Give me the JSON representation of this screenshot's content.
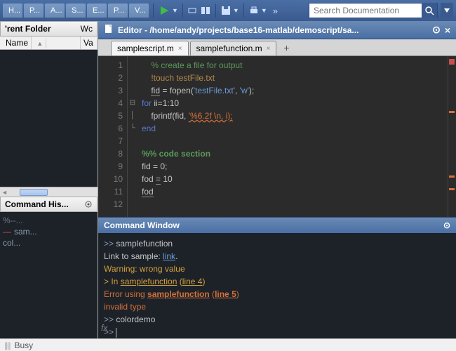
{
  "toolbar": {
    "tabs": [
      "H...",
      "P...",
      "A...",
      "S...",
      "E...",
      "P...",
      "V..."
    ],
    "search_placeholder": "Search Documentation"
  },
  "folder": {
    "title": "'rent Folder",
    "wc": "Wc",
    "col_name": "Name",
    "col_val": "Va"
  },
  "history": {
    "title": "Command His...",
    "lines": [
      "%--...",
      "sam...",
      "col..."
    ]
  },
  "editor": {
    "title": "Editor - /home/andy/projects/base16-matlab/demoscript/sa...",
    "tabs": [
      {
        "label": "samplescript.m",
        "active": true
      },
      {
        "label": "samplefunction.m",
        "active": false
      }
    ],
    "code": [
      {
        "n": 1,
        "seg": [
          {
            "t": "    ",
            "c": ""
          },
          {
            "t": "% create a file for output",
            "c": "c-comment"
          }
        ]
      },
      {
        "n": 2,
        "seg": [
          {
            "t": "    ",
            "c": ""
          },
          {
            "t": "!touch testFile.txt",
            "c": "c-cmd"
          }
        ]
      },
      {
        "n": 3,
        "seg": [
          {
            "t": "    ",
            "c": ""
          },
          {
            "t": "fid",
            "c": "c-var und"
          },
          {
            "t": " = fopen(",
            "c": "c-var"
          },
          {
            "t": "'testFile.txt'",
            "c": "c-str"
          },
          {
            "t": ", ",
            "c": "c-var"
          },
          {
            "t": "'w'",
            "c": "c-str"
          },
          {
            "t": ");",
            "c": "c-var"
          }
        ]
      },
      {
        "n": 4,
        "seg": [
          {
            "t": "for",
            "c": "c-key"
          },
          {
            "t": " ii=1:10",
            "c": "c-var"
          }
        ]
      },
      {
        "n": 5,
        "seg": [
          {
            "t": "    fprintf(fid, ",
            "c": "c-var"
          },
          {
            "t": "'%6.2f \\n, i);",
            "c": "c-err"
          }
        ]
      },
      {
        "n": 6,
        "seg": [
          {
            "t": "end",
            "c": "c-key"
          }
        ]
      },
      {
        "n": 7,
        "seg": []
      },
      {
        "n": 8,
        "seg": [
          {
            "t": "%% code section",
            "c": "c-sec"
          }
        ]
      },
      {
        "n": 9,
        "seg": [
          {
            "t": "fid = 0;",
            "c": "c-var"
          }
        ]
      },
      {
        "n": 10,
        "seg": [
          {
            "t": "fod ",
            "c": "c-var"
          },
          {
            "t": "=",
            "c": "c-var und"
          },
          {
            "t": " 10",
            "c": "c-var"
          }
        ]
      },
      {
        "n": 11,
        "seg": [
          {
            "t": "fod",
            "c": "c-var und"
          }
        ]
      },
      {
        "n": 12,
        "seg": []
      }
    ]
  },
  "cmdwin": {
    "title": "Command Window",
    "lines": [
      {
        "type": "prompt",
        "pre": ">> ",
        "text": "samplefunction"
      },
      {
        "type": "text",
        "text": "Link to sample: ",
        "link": "link",
        "post": "."
      },
      {
        "type": "warn",
        "text": "Warning: wrong value"
      },
      {
        "type": "warn",
        "text": "> In ",
        "u1": "samplefunction",
        "mid": " (",
        "u2": "line 4",
        "post": ")"
      },
      {
        "type": "err",
        "text": "Error using ",
        "u1": "samplefunction",
        "mid": " (",
        "u2": "line 5",
        "post": ")"
      },
      {
        "type": "err",
        "text": "invalid type"
      },
      {
        "type": "prompt",
        "pre": ">> ",
        "text": "colordemo"
      },
      {
        "type": "cursor",
        "pre": ">> "
      }
    ]
  },
  "status": {
    "text": "Busy"
  }
}
